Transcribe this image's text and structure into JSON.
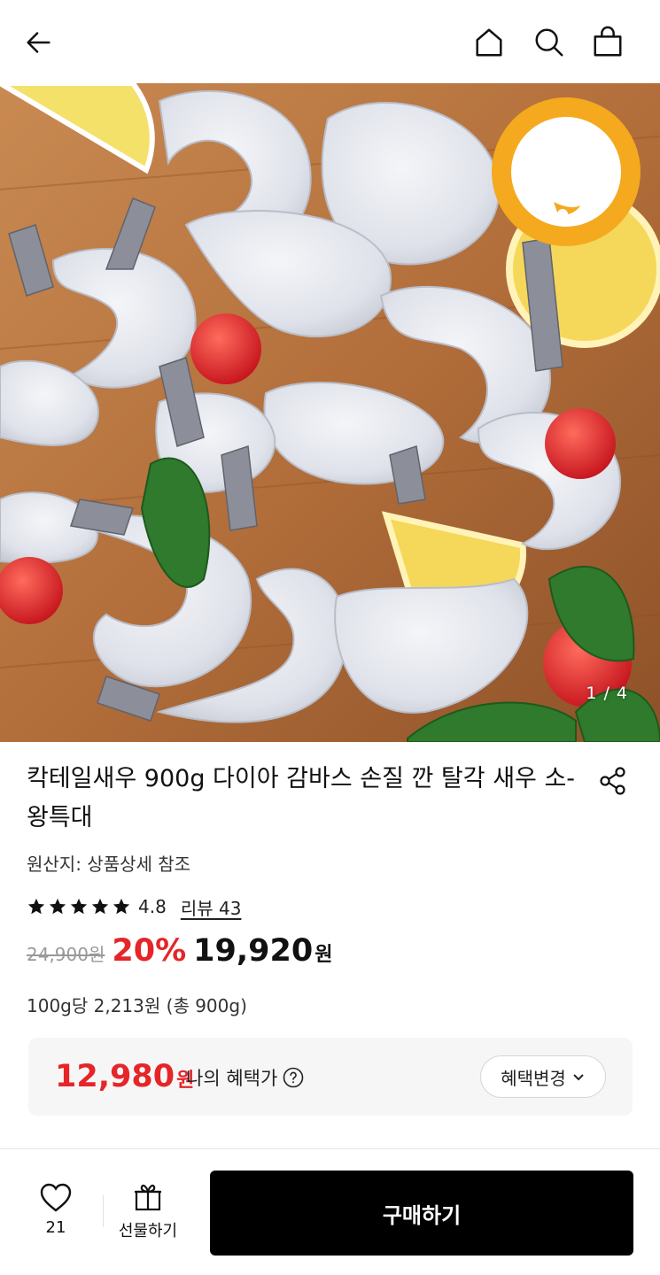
{
  "header": {
    "back_icon": "arrow-left-icon",
    "home_icon": "home-icon",
    "search_icon": "search-icon",
    "cart_icon": "shopping-bag-icon"
  },
  "gallery": {
    "counter": "1 / 4",
    "badge_color": "#f5a91e"
  },
  "product": {
    "title": "칵테일새우 900g 다이아 감바스 손질 깐 탈각 새우 소-왕특대",
    "origin": "원산지: 상품상세 참조",
    "rating": 4.8,
    "rating_text": "4.8",
    "review_link": "리뷰 43",
    "original_price": "24,900원",
    "discount": "20%",
    "sale_price": "19,920",
    "sale_currency": "원",
    "unit_price": "100g당 2,213원 (총 900g)"
  },
  "benefit": {
    "amount": "12,980",
    "currency": "원",
    "label": "나의 혜택가",
    "change_button": "혜택변경"
  },
  "bottom_bar": {
    "like_count": "21",
    "gift_label": "선물하기",
    "buy_label": "구매하기"
  },
  "colors": {
    "accent_red": "#e52528",
    "buy_button": "#000000"
  }
}
